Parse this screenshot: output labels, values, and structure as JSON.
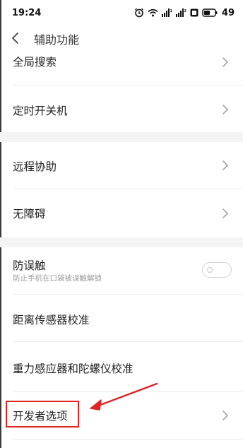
{
  "status": {
    "time": "19:24",
    "battery": "49"
  },
  "header": {
    "title": "辅助功能"
  },
  "items": {
    "global_search": "全局搜索",
    "scheduled_power": "定时开关机",
    "remote_assist": "远程协助",
    "accessibility": "无障碍",
    "anti_mistouch": "防误触",
    "anti_mistouch_desc": "防止手机在口袋被误触解锁",
    "proximity_calibration": "距离传感器校准",
    "gravity_gyro_calibration": "重力感应器和陀螺仪校准",
    "developer_options": "开发者选项"
  },
  "anti_mistouch_enabled": false,
  "colors": {
    "annotation": "#e02525",
    "section_gap": "#f4f4f4"
  }
}
